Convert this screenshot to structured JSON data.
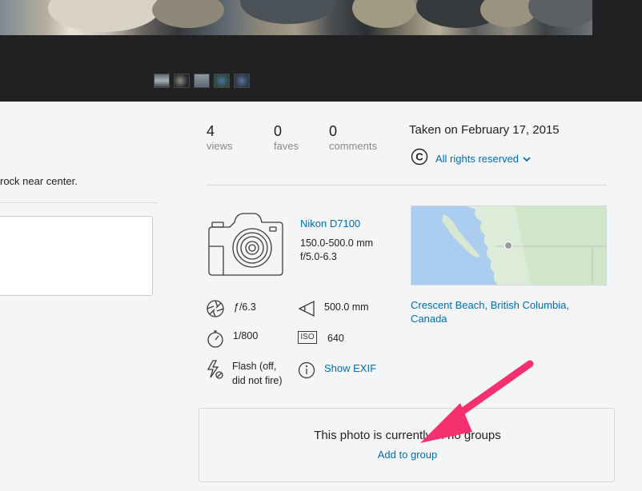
{
  "thumbnails": [
    {
      "color": "#6e7a82"
    },
    {
      "color": "#3a3c3a"
    },
    {
      "color": "#7f8a94"
    },
    {
      "color": "#3e5a52"
    },
    {
      "color": "#4a5470"
    }
  ],
  "left_panel": {
    "description_fragment": "rock near center.",
    "comment_placeholder": ""
  },
  "stats": {
    "views": {
      "value": "4",
      "label": "views"
    },
    "faves": {
      "value": "0",
      "label": "faves"
    },
    "comments": {
      "value": "0",
      "label": "comments"
    }
  },
  "taken": "Taken on February 17, 2015",
  "license": {
    "icon": "copyright-icon",
    "label": "All rights reserved"
  },
  "camera": {
    "model": "Nikon D7100",
    "lens_focal": "150.0-500.0 mm",
    "lens_aperture": "f/5.0-6.3"
  },
  "exif": {
    "aperture": "ƒ/6.3",
    "focal_length": "500.0 mm",
    "shutter": "1/800",
    "iso_label": "ISO",
    "iso": "640",
    "flash_line1": "Flash (off,",
    "flash_line2": "did not fire)",
    "show_exif": "Show EXIF"
  },
  "location": "Crescent Beach, British Columbia, Canada",
  "groups": {
    "message": "This photo is currently in no groups",
    "add_link": "Add to group"
  },
  "colors": {
    "link": "#006dac",
    "annotation_arrow": "#f5306e",
    "photo_bg": "#212124"
  }
}
